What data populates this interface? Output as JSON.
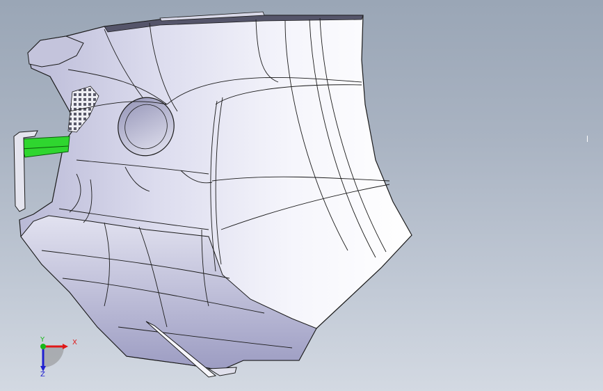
{
  "viewport": {
    "background_top": "#9aa6b6",
    "background_bottom": "#d3d9e2",
    "model_fill": "#f4f4fb",
    "model_shade": "#a6a6c8",
    "edge_color": "#1a1a1a",
    "highlight_color": "#2fd62f",
    "mesh_color": "#8a8a9a"
  },
  "triad": {
    "x_label": "X",
    "y_label": "Y",
    "z_label": "Z",
    "x_color": "#e01818",
    "y_color": "#18b818",
    "z_color": "#2020d0",
    "icon": "axis-triad-icon"
  }
}
